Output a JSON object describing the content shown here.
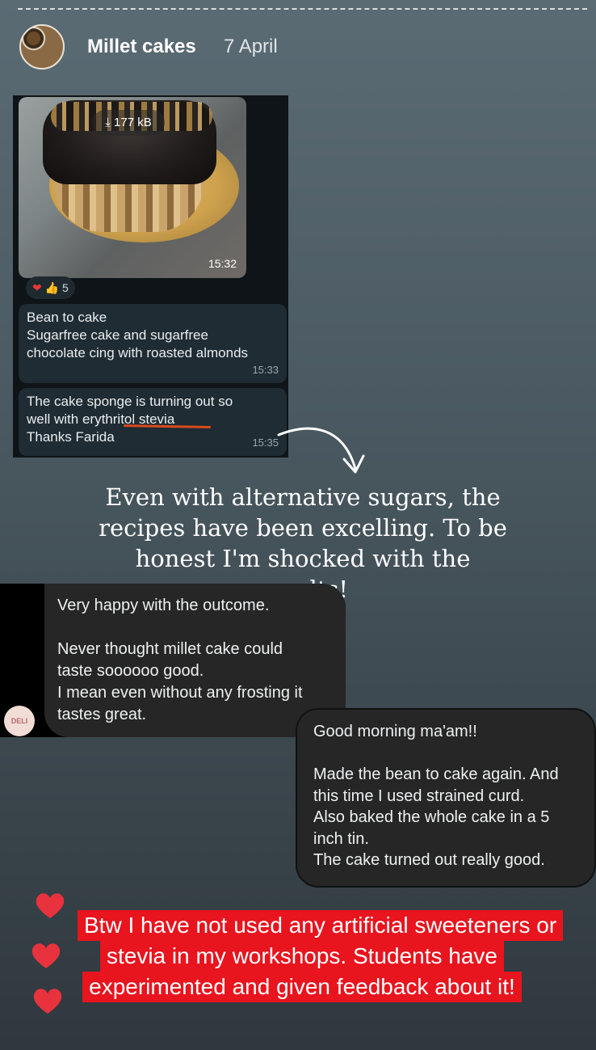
{
  "header": {
    "group_name": "Millet cakes",
    "date": "7 April"
  },
  "chat": {
    "attachment_size": "177 kB",
    "photo_time": "15:32",
    "reaction_count": "5",
    "messages": [
      {
        "text": "Bean to cake\nSugarfree cake and sugarfree\nchocolate cing with roasted almonds",
        "time": "15:33"
      },
      {
        "text": "The cake sponge is turning out so\nwell with erythritol stevia\nThanks Farida",
        "time": "15:35"
      }
    ]
  },
  "caption": "Even with alternative sugars, the recipes have been excelling.  To be honest I'm shocked with the results!",
  "review_left": {
    "avatar_text": "DELI",
    "text": "Very happy with the outcome.\n\nNever thought millet cake could\ntaste soooooo good.\nI mean even without any frosting it\ntastes great."
  },
  "review_right": {
    "text": "Good morning ma'am!!\n\nMade the bean to cake again. And\nthis time I used strained  curd.\nAlso baked the whole cake in a 5\ninch tin.\nThe cake turned out really good."
  },
  "note": {
    "lines": [
      "Btw I have not used any artificial sweeteners or",
      "stevia in my workshops.  Students have",
      "experimented and given feedback about it!"
    ]
  },
  "colors": {
    "heart": "#e8323d",
    "note_bg": "#e8141e",
    "underline": "#d94b1e"
  }
}
